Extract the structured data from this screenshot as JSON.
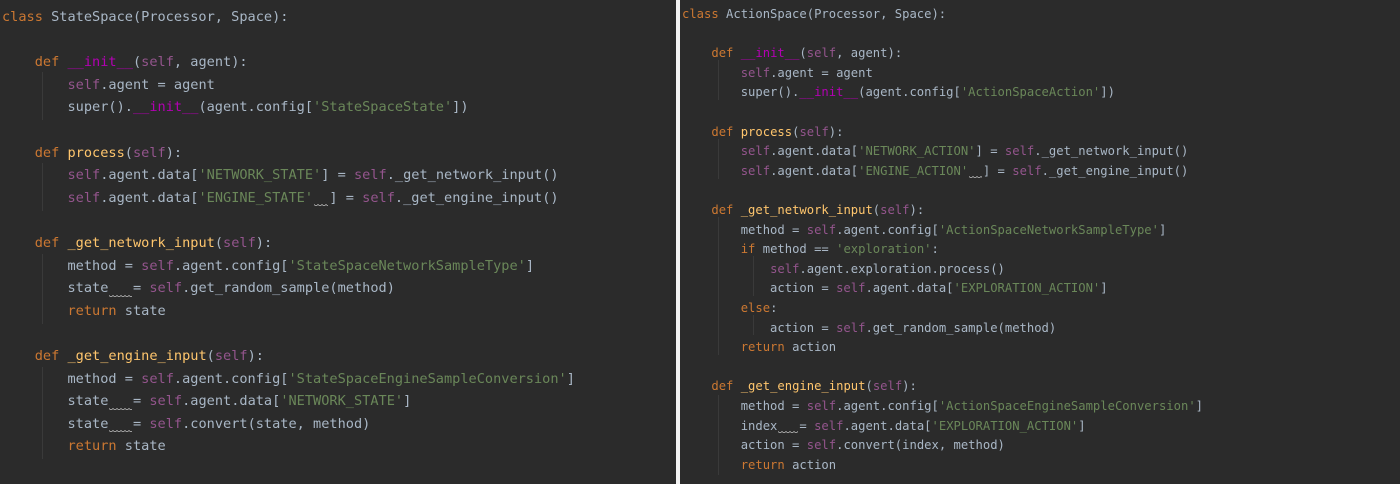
{
  "colors": {
    "background": "#2b2b2b",
    "keyword": "#cc7832",
    "plain": "#a9b7c6",
    "function": "#ffc66d",
    "dunder": "#b200b2",
    "self": "#94558d",
    "string": "#6a8759",
    "divider": "#f2f2f2"
  },
  "left_editor": {
    "lines": [
      [
        [
          "kw",
          "class"
        ],
        [
          "plain",
          " StateSpace(Processor, Space):"
        ]
      ],
      [],
      [
        [
          "plain",
          "    "
        ],
        [
          "kw",
          "def"
        ],
        [
          "plain",
          " "
        ],
        [
          "dunder",
          "__init__"
        ],
        [
          "plain",
          "("
        ],
        [
          "self",
          "self"
        ],
        [
          "plain",
          ", agent):"
        ]
      ],
      [
        [
          "plain",
          "        "
        ],
        [
          "self",
          "self"
        ],
        [
          "plain",
          ".agent = agent"
        ]
      ],
      [
        [
          "plain",
          "        super()."
        ],
        [
          "dunder",
          "__init__"
        ],
        [
          "plain",
          "(agent.config["
        ],
        [
          "str",
          "'StateSpaceState'"
        ],
        [
          "plain",
          "])"
        ]
      ],
      [],
      [
        [
          "plain",
          "    "
        ],
        [
          "kw",
          "def"
        ],
        [
          "plain",
          " "
        ],
        [
          "fn",
          "process"
        ],
        [
          "plain",
          "("
        ],
        [
          "self",
          "self"
        ],
        [
          "plain",
          "):"
        ]
      ],
      [
        [
          "plain",
          "        "
        ],
        [
          "self",
          "self"
        ],
        [
          "plain",
          ".agent.data["
        ],
        [
          "str",
          "'NETWORK_STATE'"
        ],
        [
          "plain",
          "] = "
        ],
        [
          "self",
          "self"
        ],
        [
          "plain",
          "._get_network_input()"
        ]
      ],
      [
        [
          "plain",
          "        "
        ],
        [
          "self",
          "self"
        ],
        [
          "plain",
          ".agent.data["
        ],
        [
          "str",
          "'ENGINE_STATE'"
        ],
        [
          "ws",
          "  "
        ],
        [
          "plain",
          "] = "
        ],
        [
          "self",
          "self"
        ],
        [
          "plain",
          "._get_engine_input()"
        ]
      ],
      [],
      [
        [
          "plain",
          "    "
        ],
        [
          "kw",
          "def"
        ],
        [
          "plain",
          " "
        ],
        [
          "fn",
          "_get_network_input"
        ],
        [
          "plain",
          "("
        ],
        [
          "self",
          "self"
        ],
        [
          "plain",
          "):"
        ]
      ],
      [
        [
          "plain",
          "        method = "
        ],
        [
          "self",
          "self"
        ],
        [
          "plain",
          ".agent.config["
        ],
        [
          "str",
          "'StateSpaceNetworkSampleType'"
        ],
        [
          "plain",
          "]"
        ]
      ],
      [
        [
          "plain",
          "        state"
        ],
        [
          "ws",
          "   "
        ],
        [
          "plain",
          "= "
        ],
        [
          "self",
          "self"
        ],
        [
          "plain",
          ".get_random_sample(method)"
        ]
      ],
      [
        [
          "plain",
          "        "
        ],
        [
          "kw",
          "return"
        ],
        [
          "plain",
          " state"
        ]
      ],
      [],
      [
        [
          "plain",
          "    "
        ],
        [
          "kw",
          "def"
        ],
        [
          "plain",
          " "
        ],
        [
          "fn",
          "_get_engine_input"
        ],
        [
          "plain",
          "("
        ],
        [
          "self",
          "self"
        ],
        [
          "plain",
          "):"
        ]
      ],
      [
        [
          "plain",
          "        method = "
        ],
        [
          "self",
          "self"
        ],
        [
          "plain",
          ".agent.config["
        ],
        [
          "str",
          "'StateSpaceEngineSampleConversion'"
        ],
        [
          "plain",
          "]"
        ]
      ],
      [
        [
          "plain",
          "        state"
        ],
        [
          "ws",
          "   "
        ],
        [
          "plain",
          "= "
        ],
        [
          "self",
          "self"
        ],
        [
          "plain",
          ".agent.data["
        ],
        [
          "str",
          "'NETWORK_STATE'"
        ],
        [
          "plain",
          "]"
        ]
      ],
      [
        [
          "plain",
          "        state"
        ],
        [
          "ws",
          "   "
        ],
        [
          "plain",
          "= "
        ],
        [
          "self",
          "self"
        ],
        [
          "plain",
          ".convert(state, method)"
        ]
      ],
      [
        [
          "plain",
          "        "
        ],
        [
          "kw",
          "return"
        ],
        [
          "plain",
          " state"
        ]
      ]
    ]
  },
  "right_editor": {
    "lines": [
      [
        [
          "kw",
          "class"
        ],
        [
          "plain",
          " ActionSpace(Processor, Space):"
        ]
      ],
      [],
      [
        [
          "plain",
          "    "
        ],
        [
          "kw",
          "def"
        ],
        [
          "plain",
          " "
        ],
        [
          "dunder",
          "__init__"
        ],
        [
          "plain",
          "("
        ],
        [
          "self",
          "self"
        ],
        [
          "plain",
          ", agent):"
        ]
      ],
      [
        [
          "plain",
          "        "
        ],
        [
          "self",
          "self"
        ],
        [
          "plain",
          ".agent = agent"
        ]
      ],
      [
        [
          "plain",
          "        super()."
        ],
        [
          "dunder",
          "__init__"
        ],
        [
          "plain",
          "(agent.config["
        ],
        [
          "str",
          "'ActionSpaceAction'"
        ],
        [
          "plain",
          "])"
        ]
      ],
      [],
      [
        [
          "plain",
          "    "
        ],
        [
          "kw",
          "def"
        ],
        [
          "plain",
          " "
        ],
        [
          "fn",
          "process"
        ],
        [
          "plain",
          "("
        ],
        [
          "self",
          "self"
        ],
        [
          "plain",
          "):"
        ]
      ],
      [
        [
          "plain",
          "        "
        ],
        [
          "self",
          "self"
        ],
        [
          "plain",
          ".agent.data["
        ],
        [
          "str",
          "'NETWORK_ACTION'"
        ],
        [
          "plain",
          "] = "
        ],
        [
          "self",
          "self"
        ],
        [
          "plain",
          "._get_network_input()"
        ]
      ],
      [
        [
          "plain",
          "        "
        ],
        [
          "self",
          "self"
        ],
        [
          "plain",
          ".agent.data["
        ],
        [
          "str",
          "'ENGINE_ACTION'"
        ],
        [
          "ws",
          "  "
        ],
        [
          "plain",
          "] = "
        ],
        [
          "self",
          "self"
        ],
        [
          "plain",
          "._get_engine_input()"
        ]
      ],
      [],
      [
        [
          "plain",
          "    "
        ],
        [
          "kw",
          "def"
        ],
        [
          "plain",
          " "
        ],
        [
          "fn",
          "_get_network_input"
        ],
        [
          "plain",
          "("
        ],
        [
          "self",
          "self"
        ],
        [
          "plain",
          "):"
        ]
      ],
      [
        [
          "plain",
          "        method = "
        ],
        [
          "self",
          "self"
        ],
        [
          "plain",
          ".agent.config["
        ],
        [
          "str",
          "'ActionSpaceNetworkSampleType'"
        ],
        [
          "plain",
          "]"
        ]
      ],
      [
        [
          "plain",
          "        "
        ],
        [
          "kw",
          "if"
        ],
        [
          "plain",
          " method == "
        ],
        [
          "str",
          "'exploration'"
        ],
        [
          "plain",
          ":"
        ]
      ],
      [
        [
          "plain",
          "            "
        ],
        [
          "self",
          "self"
        ],
        [
          "plain",
          ".agent.exploration.process()"
        ]
      ],
      [
        [
          "plain",
          "            action = "
        ],
        [
          "self",
          "self"
        ],
        [
          "plain",
          ".agent.data["
        ],
        [
          "str",
          "'EXPLORATION_ACTION'"
        ],
        [
          "plain",
          "]"
        ]
      ],
      [
        [
          "plain",
          "        "
        ],
        [
          "kw",
          "else"
        ],
        [
          "plain",
          ":"
        ]
      ],
      [
        [
          "plain",
          "            action = "
        ],
        [
          "self",
          "self"
        ],
        [
          "plain",
          ".get_random_sample(method)"
        ]
      ],
      [
        [
          "plain",
          "        "
        ],
        [
          "kw",
          "return"
        ],
        [
          "plain",
          " action"
        ]
      ],
      [],
      [
        [
          "plain",
          "    "
        ],
        [
          "kw",
          "def"
        ],
        [
          "plain",
          " "
        ],
        [
          "fn",
          "_get_engine_input"
        ],
        [
          "plain",
          "("
        ],
        [
          "self",
          "self"
        ],
        [
          "plain",
          "):"
        ]
      ],
      [
        [
          "plain",
          "        method = "
        ],
        [
          "self",
          "self"
        ],
        [
          "plain",
          ".agent.config["
        ],
        [
          "str",
          "'ActionSpaceEngineSampleConversion'"
        ],
        [
          "plain",
          "]"
        ]
      ],
      [
        [
          "plain",
          "        index"
        ],
        [
          "ws",
          "   "
        ],
        [
          "plain",
          "= "
        ],
        [
          "self",
          "self"
        ],
        [
          "plain",
          ".agent.data["
        ],
        [
          "str",
          "'EXPLORATION_ACTION'"
        ],
        [
          "plain",
          "]"
        ]
      ],
      [
        [
          "plain",
          "        action = "
        ],
        [
          "self",
          "self"
        ],
        [
          "plain",
          ".convert(index, method)"
        ]
      ],
      [
        [
          "plain",
          "        "
        ],
        [
          "kw",
          "return"
        ],
        [
          "plain",
          " action"
        ]
      ]
    ]
  }
}
